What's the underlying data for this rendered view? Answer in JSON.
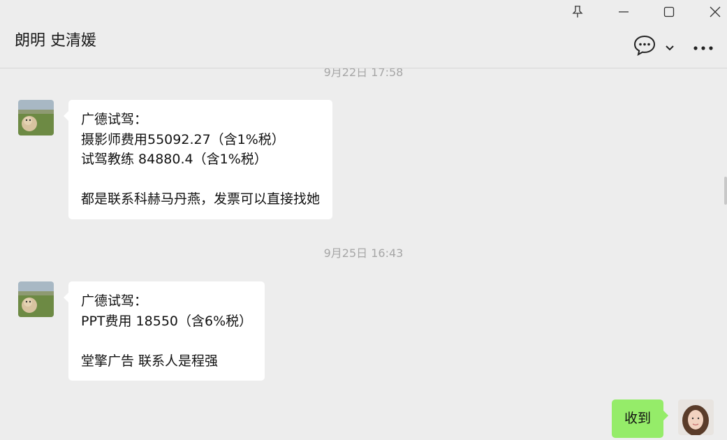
{
  "window": {
    "title": "朗明 史清媛",
    "controls": [
      "pin-icon",
      "minimize-icon",
      "maximize-icon",
      "close-icon"
    ]
  },
  "header": {
    "buttons": [
      "chat-bubble-icon",
      "chevron-down-icon",
      "more-icon"
    ]
  },
  "messages": [
    {
      "type": "timestamp",
      "text": "9月22日 17:58"
    },
    {
      "type": "received",
      "text": "广德试驾：\n摄影师费用55092.27（含1%税）\n试驾教练 84880.4（含1%税）\n\n都是联系科赫马丹燕，发票可以直接找她"
    },
    {
      "type": "timestamp",
      "text": "9月25日 16:43"
    },
    {
      "type": "received",
      "text": "广德试驾：\nPPT费用 18550（含6%税）\n\n堂擎广告 联系人是程强"
    },
    {
      "type": "sent",
      "text": "收到"
    }
  ],
  "colors": {
    "background": "#ededed",
    "received_bubble": "#ffffff",
    "sent_bubble": "#95ec69",
    "timestamp": "#a6a6a6"
  }
}
